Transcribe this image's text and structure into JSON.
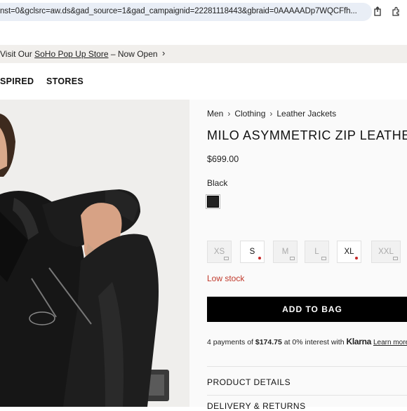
{
  "browser": {
    "url": "nst=0&gclsrc=aw.ds&gad_source=1&gad_campaignid=22281118443&gbraid=0AAAAADp7WQCFfh..."
  },
  "announcement": {
    "prefix": "Visit Our ",
    "link": "SoHo Pop Up Store",
    "suffix": " – Now Open",
    "chevron": "›"
  },
  "nav": {
    "items": [
      "SPIRED",
      "STORES"
    ]
  },
  "product": {
    "breadcrumbs": [
      "Men",
      "Clothing",
      "Leather Jackets"
    ],
    "breadcrumb_separator": "›",
    "title": "MILO ASYMMETRIC ZIP LEATHER",
    "price": "$699.00",
    "color_name": "Black",
    "swatch_color": "#222222",
    "sizes": [
      {
        "label": "XS",
        "state": "notify"
      },
      {
        "label": "S",
        "state": "low"
      },
      {
        "label": "M",
        "state": "notify"
      },
      {
        "label": "L",
        "state": "notify"
      },
      {
        "label": "XL",
        "state": "low"
      },
      {
        "label": "XXL",
        "state": "notify"
      }
    ],
    "stock_status": "Low stock",
    "add_to_bag": "ADD TO BAG",
    "klarna": {
      "prefix": "4 payments of ",
      "amount": "$174.75",
      "middle": " at 0% interest with ",
      "brand": "Klarna",
      "learn_more": "Learn more"
    },
    "sections": [
      "PRODUCT DETAILS",
      "DELIVERY & RETURNS"
    ]
  },
  "colors": {
    "accent_low_stock": "#c0392b",
    "button_bg": "#000000",
    "panel_bg": "#fafafa"
  }
}
